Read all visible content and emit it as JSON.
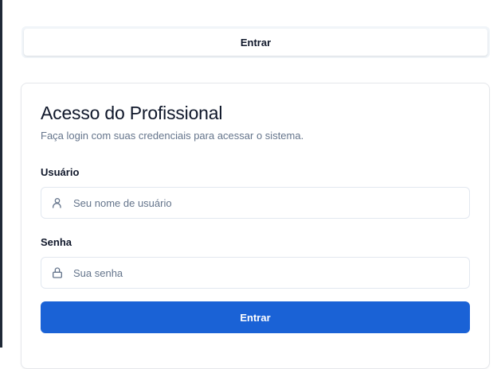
{
  "tabs": {
    "active_label": "Entrar"
  },
  "login_card": {
    "title": "Acesso do Profissional",
    "description": "Faça login com suas credenciais para acessar o sistema.",
    "username": {
      "label": "Usuário",
      "placeholder": "Seu nome de usuário",
      "value": "",
      "icon": "user-icon"
    },
    "password": {
      "label": "Senha",
      "placeholder": "Sua senha",
      "value": "",
      "icon": "lock-icon"
    },
    "submit_label": "Entrar"
  },
  "colors": {
    "primary": "#1a62d6",
    "muted_text": "#64748b",
    "border": "#e2e8f0"
  }
}
